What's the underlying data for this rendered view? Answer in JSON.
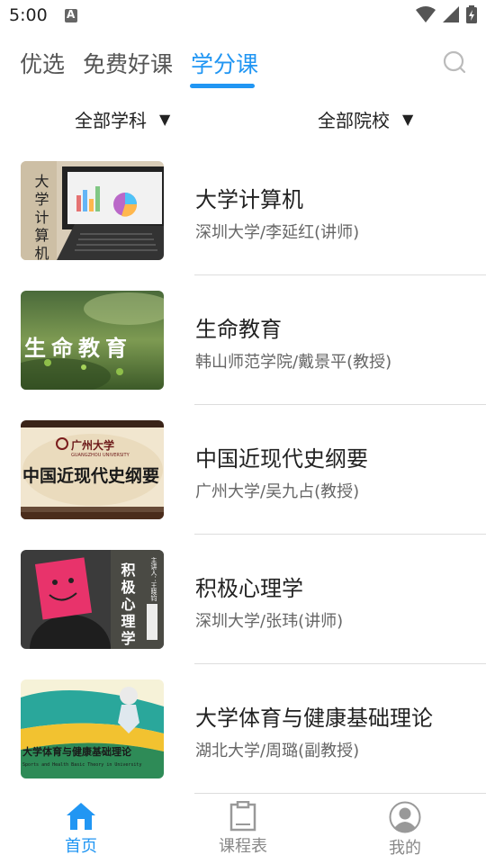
{
  "status": {
    "time": "5:00"
  },
  "tabs": [
    {
      "label": "优选"
    },
    {
      "label": "免费好课"
    },
    {
      "label": "学分课"
    }
  ],
  "filters": {
    "subject": "全部学科",
    "school": "全部院校"
  },
  "courses": [
    {
      "title": "大学计算机",
      "subtitle": "深圳大学/李延红(讲师)",
      "thumb_text": "大学计算机"
    },
    {
      "title": "生命教育",
      "subtitle": "韩山师范学院/戴景平(教授)",
      "thumb_text": "生命教育"
    },
    {
      "title": "中国近现代史纲要",
      "subtitle": "广州大学/吴九占(教授)",
      "thumb_text": "中国近现代史纲要",
      "thumb_logo": "广州大学",
      "thumb_logo_en": "GUANGZHOU UNIVERSITY"
    },
    {
      "title": "积极心理学",
      "subtitle": "深圳大学/张玮(讲师)",
      "thumb_text": "积极心理学",
      "thumb_lecturer": "主讲人：王晓钧"
    },
    {
      "title": "大学体育与健康基础理论",
      "subtitle": "湖北大学/周璐(副教授)",
      "thumb_text": "大学体育与健康基础理论",
      "thumb_text_en": "Sports and Health Basic Theory in University"
    }
  ],
  "bottom_nav": [
    {
      "label": "首页"
    },
    {
      "label": "课程表"
    },
    {
      "label": "我的"
    }
  ],
  "colors": {
    "accent": "#2196F3",
    "text": "#222222",
    "secondary": "#666666"
  }
}
